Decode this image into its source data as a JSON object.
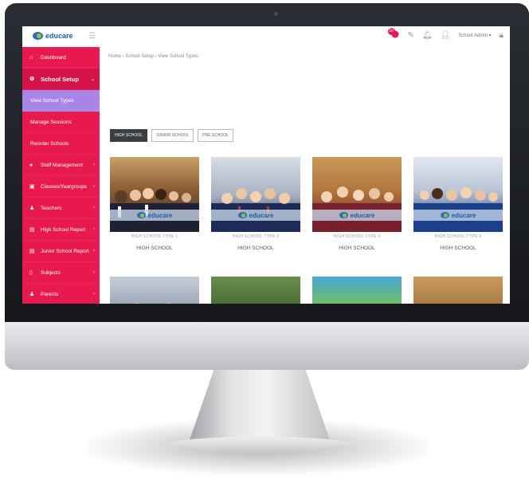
{
  "topbar": {
    "logo_text": "educare",
    "notification_count": "10",
    "user_label": "School Admin ▾"
  },
  "sidebar": {
    "items": [
      {
        "label": "Dashboard",
        "icon": "home-icon"
      },
      {
        "label": "School Setup",
        "icon": "gear-icon"
      },
      {
        "label": "View School Types"
      },
      {
        "label": "Manage Sessions"
      },
      {
        "label": "Reorder Schools"
      },
      {
        "label": "Staff Management",
        "icon": "user-icon"
      },
      {
        "label": "Classes/Yeargroups",
        "icon": "book-icon"
      },
      {
        "label": "Teachers",
        "icon": "users-icon"
      },
      {
        "label": "High School Report",
        "icon": "report-icon"
      },
      {
        "label": "Junior School Report",
        "icon": "report-icon"
      },
      {
        "label": "Subjects",
        "icon": "file-icon"
      },
      {
        "label": "Parents",
        "icon": "users-icon"
      }
    ]
  },
  "breadcrumb": "Home › School Setup › View School Types",
  "tabs": [
    {
      "label": "HIGH SCHOOL"
    },
    {
      "label": "JUNIOR SCHOOL"
    },
    {
      "label": "PRE SCHOOL"
    }
  ],
  "cards": [
    {
      "type_label": "HIGH SCHOOL TYPE 1",
      "category": "HIGH SCHOOL",
      "logo": "educare"
    },
    {
      "type_label": "HIGH SCHOOL TYPE 2",
      "category": "HIGH SCHOOL",
      "logo": "educare"
    },
    {
      "type_label": "HIGH SCHOOL TYPE 3",
      "category": "HIGH SCHOOL",
      "logo": "educare"
    },
    {
      "type_label": "HIGH SCHOOL TYPE 4",
      "category": "HIGH SCHOOL",
      "logo": "educare"
    },
    {
      "type_label": "",
      "category": "",
      "logo": ""
    },
    {
      "type_label": "",
      "category": "",
      "logo": ""
    },
    {
      "type_label": "",
      "category": "",
      "logo": ""
    },
    {
      "type_label": "",
      "category": "",
      "logo": ""
    }
  ],
  "colors": {
    "sidebar": "#e8194f",
    "active_item": "#a985e8",
    "brand": "#1d5fa8"
  }
}
